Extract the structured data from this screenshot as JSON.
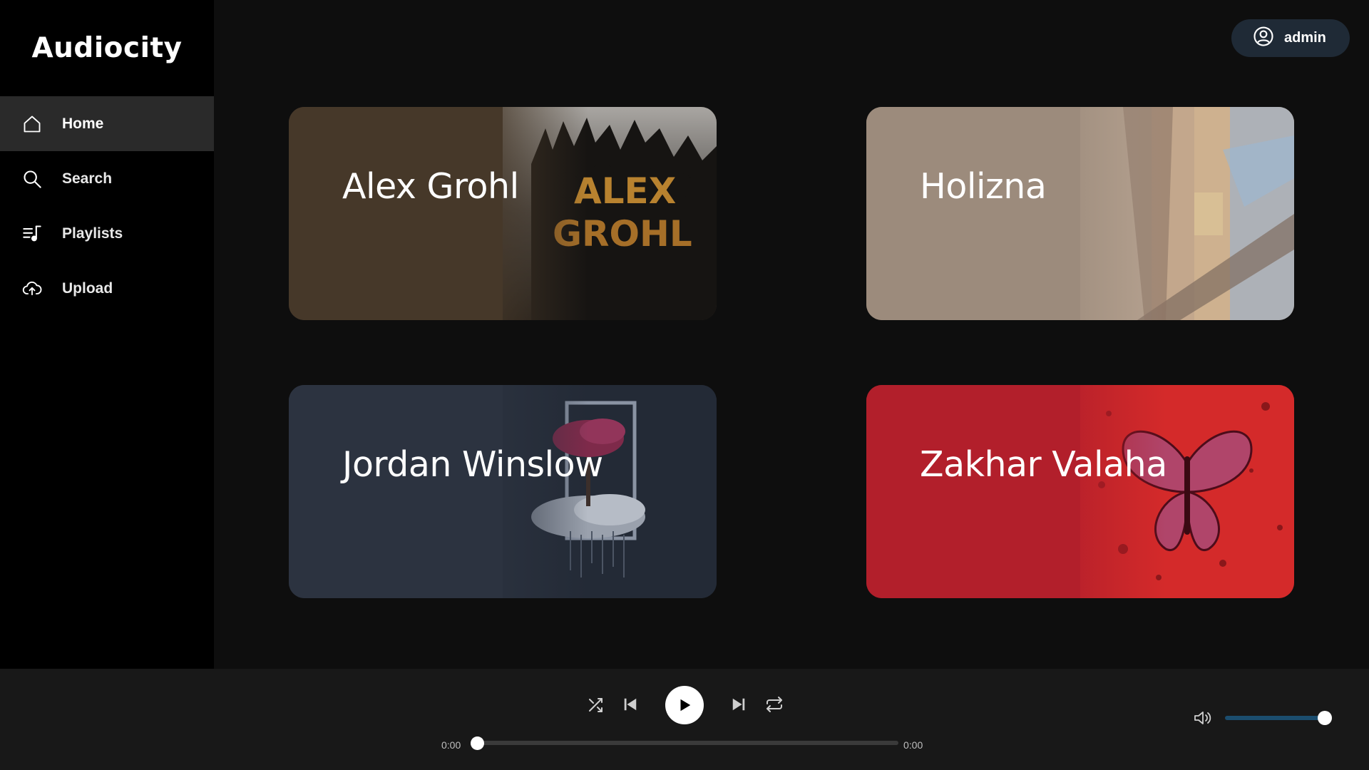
{
  "app": {
    "title": "Audiocity"
  },
  "sidebar": {
    "items": [
      {
        "label": "Home",
        "icon": "home-icon",
        "active": true
      },
      {
        "label": "Search",
        "icon": "search-icon",
        "active": false
      },
      {
        "label": "Playlists",
        "icon": "playlist-icon",
        "active": false
      },
      {
        "label": "Upload",
        "icon": "upload-icon",
        "active": false
      }
    ]
  },
  "header": {
    "user_label": "admin",
    "user_icon": "user-circle-icon"
  },
  "artists": [
    {
      "name": "Alex Grohl",
      "color": "#463829",
      "art_text": [
        "ALEX",
        "GROHL"
      ]
    },
    {
      "name": "Holizna",
      "color": "#9c8b7c"
    },
    {
      "name": "Jordan Winslow",
      "color": "#2c3340"
    },
    {
      "name": "Zakhar Valaha",
      "color": "#b21f2b"
    }
  ],
  "player": {
    "current_time": "0:00",
    "total_time": "0:00",
    "progress": 0,
    "volume": 1.0,
    "controls": [
      "shuffle-icon",
      "previous-icon",
      "play-icon",
      "next-icon",
      "repeat-icon",
      "volume-icon"
    ]
  },
  "colors": {
    "sidebar_bg": "#000000",
    "main_bg": "#0e0e0e",
    "player_bg": "#181818",
    "active_nav": "#2a2a2a",
    "user_button": "#1f2a36",
    "volume_fill": "#1b4d6e"
  }
}
